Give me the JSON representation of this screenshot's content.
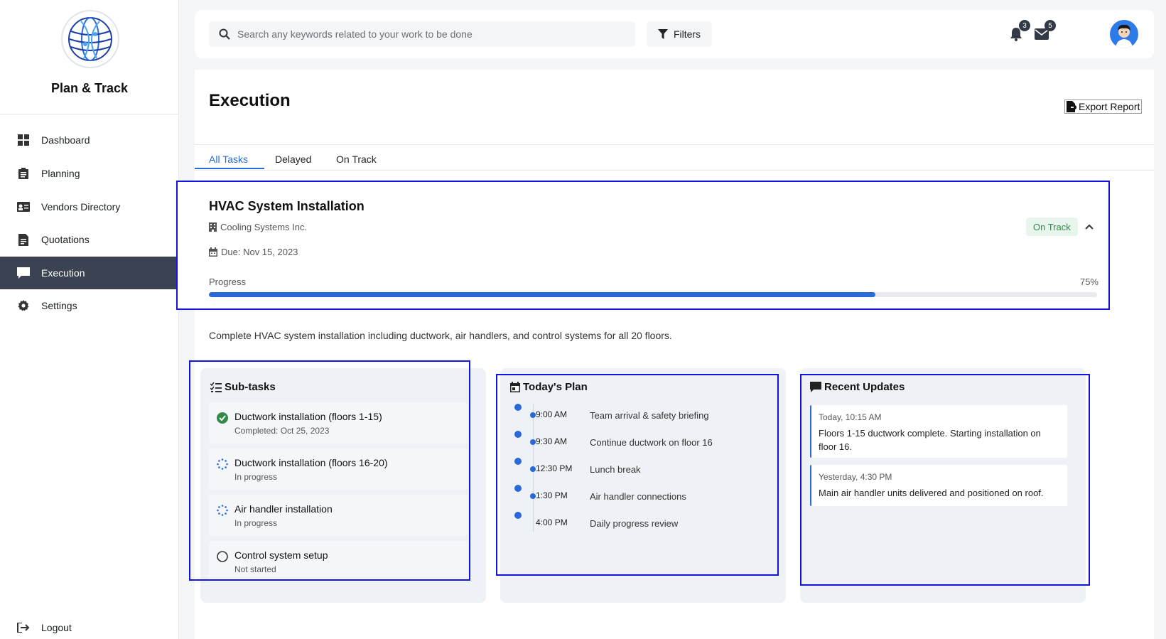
{
  "app": {
    "name": "Plan & Track"
  },
  "sidebar": {
    "items": [
      {
        "label": "Dashboard",
        "icon": "dashboard-icon"
      },
      {
        "label": "Planning",
        "icon": "clipboard-icon"
      },
      {
        "label": "Vendors Directory",
        "icon": "address-card-icon"
      },
      {
        "label": "Quotations",
        "icon": "invoice-icon"
      },
      {
        "label": "Execution",
        "icon": "chat-icon",
        "active": true
      },
      {
        "label": "Settings",
        "icon": "gear-icon"
      }
    ],
    "logout_label": "Logout"
  },
  "topbar": {
    "search_placeholder": "Search any keywords related to your work to be done",
    "filters_label": "Filters",
    "notifications_count": "3",
    "messages_count": "5"
  },
  "page": {
    "title": "Execution",
    "export_label": "Export Report",
    "tabs": [
      "All Tasks",
      "Delayed",
      "On Track"
    ],
    "active_tab": "All Tasks"
  },
  "task": {
    "title": "HVAC System Installation",
    "vendor": "Cooling Systems Inc.",
    "due": "Due: Nov 15, 2023",
    "status": "On Track",
    "progress_label": "Progress",
    "progress_text": "75%",
    "progress_fraction": 0.75,
    "description": "Complete HVAC system installation including ductwork, air handlers, and control systems for all 20 floors."
  },
  "subtasks": {
    "title": "Sub-tasks",
    "items": [
      {
        "name": "Ductwork installation (floors 1-15)",
        "status": "Completed: Oct 25, 2023",
        "state": "completed"
      },
      {
        "name": "Ductwork installation (floors 16-20)",
        "status": "In progress",
        "state": "in-progress"
      },
      {
        "name": "Air handler installation",
        "status": "In progress",
        "state": "in-progress"
      },
      {
        "name": "Control system setup",
        "status": "Not started",
        "state": "not-started"
      }
    ]
  },
  "plan": {
    "title": "Today's Plan",
    "items": [
      {
        "time": "9:00 AM",
        "activity": "Team arrival & safety briefing"
      },
      {
        "time": "9:30 AM",
        "activity": "Continue ductwork on floor 16"
      },
      {
        "time": "12:30 PM",
        "activity": "Lunch break"
      },
      {
        "time": "1:30 PM",
        "activity": "Air handler connections"
      },
      {
        "time": "4:00 PM",
        "activity": "Daily progress review"
      }
    ]
  },
  "updates": {
    "title": "Recent Updates",
    "items": [
      {
        "time": "Today, 10:15 AM",
        "text": "Floors 1-15 ductwork complete. Starting installation on floor 16."
      },
      {
        "time": "Yesterday, 4:30 PM",
        "text": "Main air handler units delivered and positioned on roof."
      }
    ]
  },
  "colors": {
    "accent": "#2a6ad8",
    "active_nav": "#3b4252",
    "on_track": "#2f8b45",
    "highlight_outline": "#1414e0"
  }
}
